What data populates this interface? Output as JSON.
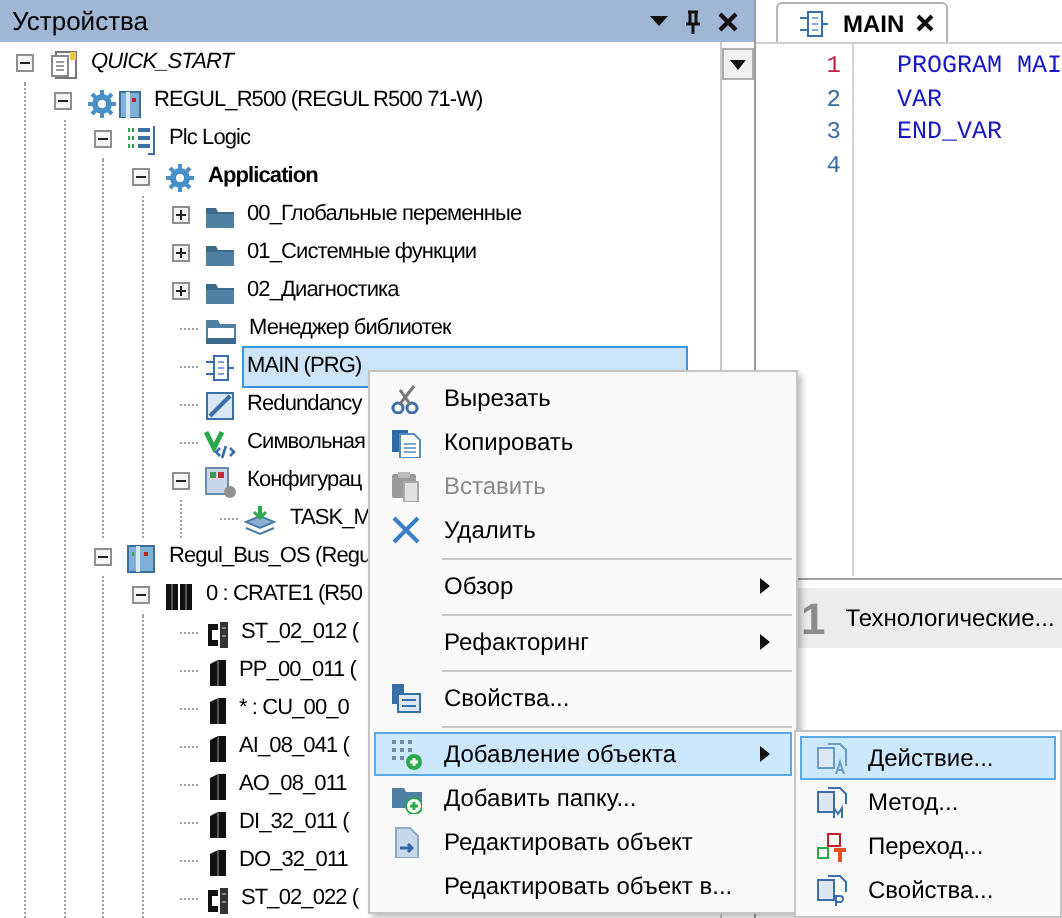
{
  "devices_panel": {
    "title": "Устройства",
    "tree": [
      {
        "label": "QUICK_START",
        "kind": "project",
        "expanded": true,
        "selected": false,
        "children": [
          {
            "label": "REGUL_R500 (REGUL R500 71-W)",
            "kind": "device",
            "expanded": true,
            "selected": false,
            "children": [
              {
                "label": "Plc Logic",
                "kind": "plc-logic",
                "expanded": true,
                "selected": false,
                "children": [
                  {
                    "label": "Application",
                    "kind": "application",
                    "expanded": true,
                    "selected": false,
                    "children": [
                      {
                        "label": "00_Глобальные переменные",
                        "kind": "folder",
                        "expanded": false,
                        "selected": false
                      },
                      {
                        "label": "01_Системные функции",
                        "kind": "folder",
                        "expanded": false,
                        "selected": false
                      },
                      {
                        "label": "02_Диагностика",
                        "kind": "folder",
                        "expanded": false,
                        "selected": false
                      },
                      {
                        "label": "Менеджер библиотек",
                        "kind": "library",
                        "selected": false
                      },
                      {
                        "label": "MAIN (PRG)",
                        "kind": "program",
                        "selected": true
                      },
                      {
                        "label": "Redundancy",
                        "kind": "redundancy",
                        "selected": false
                      },
                      {
                        "label": "Символьная",
                        "kind": "symbols",
                        "selected": false
                      },
                      {
                        "label": "Конфигурац",
                        "kind": "task-config",
                        "expanded": true,
                        "selected": false,
                        "children": [
                          {
                            "label": "TASK_M",
                            "kind": "task",
                            "selected": false
                          }
                        ]
                      }
                    ]
                  }
                ]
              },
              {
                "label": "Regul_Bus_OS (Regu",
                "kind": "bus",
                "expanded": true,
                "selected": false,
                "children": [
                  {
                    "label": "0 : CRATE1 (R50",
                    "kind": "crate",
                    "expanded": true,
                    "selected": false,
                    "children": [
                      {
                        "label": "ST_02_012 (",
                        "kind": "terminal",
                        "selected": false
                      },
                      {
                        "label": "PP_00_011 (",
                        "kind": "module",
                        "selected": false
                      },
                      {
                        "label": "* : CU_00_0",
                        "kind": "module",
                        "selected": false
                      },
                      {
                        "label": "AI_08_041 (",
                        "kind": "module",
                        "selected": false
                      },
                      {
                        "label": "AO_08_011",
                        "kind": "module",
                        "selected": false
                      },
                      {
                        "label": "DI_32_011 (",
                        "kind": "module",
                        "selected": false
                      },
                      {
                        "label": "DO_32_011",
                        "kind": "module",
                        "selected": false
                      },
                      {
                        "label": "ST_02_022 (",
                        "kind": "terminal",
                        "selected": false
                      }
                    ]
                  }
                ]
              }
            ]
          }
        ]
      }
    ]
  },
  "editor": {
    "tab": {
      "label": "MAIN",
      "selected": true
    },
    "lines": [
      {
        "number": "1",
        "code": "PROGRAM MAI",
        "current": true
      },
      {
        "number": "2",
        "code": "VAR",
        "current": false
      },
      {
        "number": "3",
        "code": "END_VAR",
        "current": false
      },
      {
        "number": "4",
        "current": false
      }
    ]
  },
  "bottom_pane": {
    "number": "1",
    "label": "Технологические..."
  },
  "context_menu": [
    {
      "kind": "cut",
      "label": "Вырезать",
      "disabled": false,
      "selected": false
    },
    {
      "kind": "copy",
      "label": "Копировать",
      "disabled": false,
      "selected": false
    },
    {
      "kind": "paste",
      "label": "Вставить",
      "disabled": true,
      "selected": false
    },
    {
      "kind": "delete",
      "label": "Удалить",
      "disabled": false,
      "selected": false
    },
    {
      "kind": "separator"
    },
    {
      "kind": "plain",
      "label": "Обзор",
      "submenu": true,
      "disabled": false,
      "selected": false
    },
    {
      "kind": "separator"
    },
    {
      "kind": "plain",
      "label": "Рефакторинг",
      "submenu": true,
      "disabled": false,
      "selected": false
    },
    {
      "kind": "separator"
    },
    {
      "kind": "properties",
      "label": "Свойства...",
      "disabled": false,
      "selected": false
    },
    {
      "kind": "separator"
    },
    {
      "kind": "add-object",
      "label": "Добавление объекта",
      "submenu": true,
      "disabled": false,
      "selected": true
    },
    {
      "kind": "add-folder",
      "label": "Добавить папку...",
      "disabled": false,
      "selected": false
    },
    {
      "kind": "edit",
      "label": "Редактировать объект",
      "disabled": false,
      "selected": false
    },
    {
      "kind": "plain",
      "label": "Редактировать объект в...",
      "disabled": false,
      "selected": false
    }
  ],
  "submenu": [
    {
      "label": "Действие...",
      "kind": "action",
      "selected": true
    },
    {
      "label": "Метод...",
      "kind": "method",
      "selected": false
    },
    {
      "label": "Переход...",
      "kind": "transition",
      "selected": false
    },
    {
      "label": "Свойства...",
      "kind": "obj-properties",
      "selected": false
    }
  ]
}
